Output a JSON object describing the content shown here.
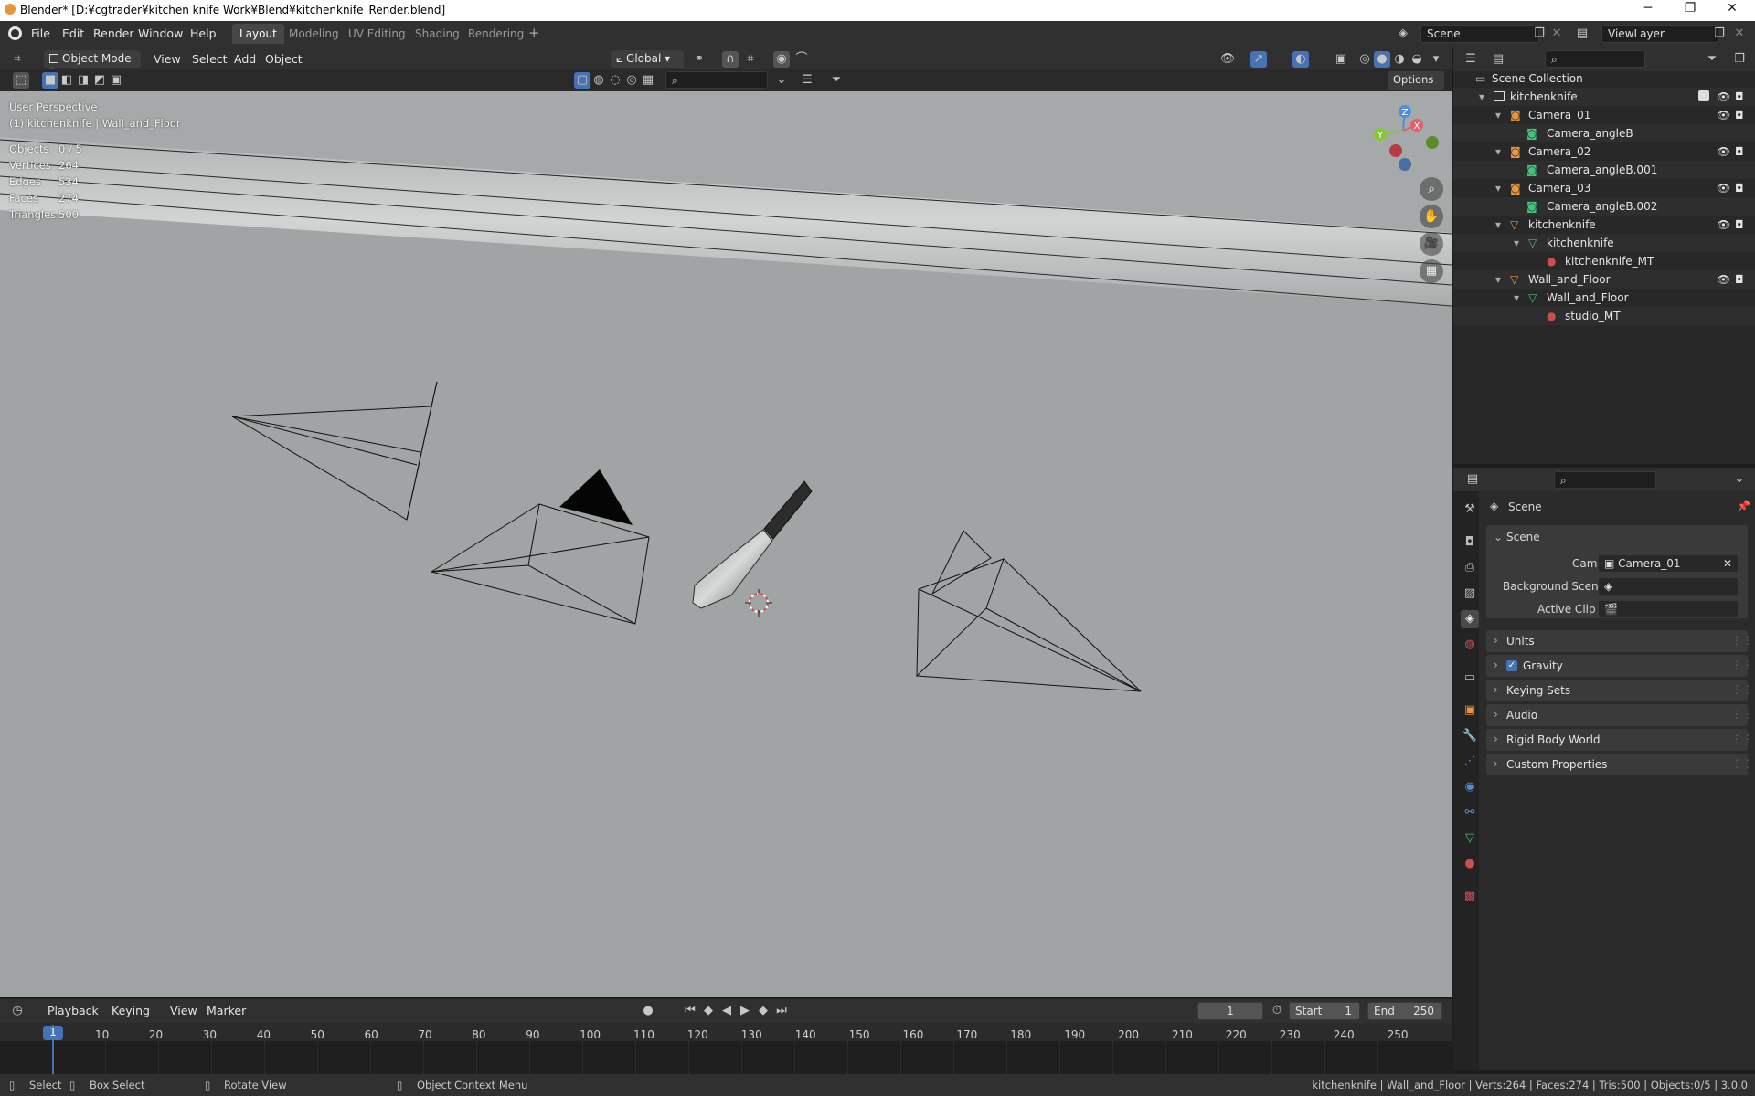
{
  "window": {
    "title": "Blender* [D:¥cgtrader¥kitchen knife Work¥Blend¥kitchenknife_Render.blend]",
    "controls": [
      "─",
      "❐",
      "✕"
    ]
  },
  "menubar": {
    "items": [
      "File",
      "Edit",
      "Render",
      "Window",
      "Help"
    ],
    "workspaces": [
      "Layout",
      "Modeling",
      "UV Editing",
      "Shading",
      "Rendering"
    ],
    "add_tab": "+",
    "scene_name": "Scene",
    "view_layer": "ViewLayer"
  },
  "viewport_header": {
    "mode": "Object Mode",
    "menus": [
      "View",
      "Select",
      "Add",
      "Object"
    ],
    "transform_orientation": "Global",
    "options_label": "Options"
  },
  "viewport": {
    "perspective": "User Perspective",
    "active": "(1) kitchenknife | Wall_and_Floor",
    "stats": [
      {
        "label": "Objects",
        "value": "0 / 5"
      },
      {
        "label": "Vertices",
        "value": "264"
      },
      {
        "label": "Edges",
        "value": "534"
      },
      {
        "label": "Faces",
        "value": "274"
      },
      {
        "label": "Triangles",
        "value": "500"
      }
    ],
    "gizmo_axes": {
      "z": "Z",
      "y": "Y",
      "x": "X"
    },
    "background_color": "#a1a4a4"
  },
  "outliner": {
    "root": "Scene Collection",
    "rows": [
      {
        "label": "kitchenknife",
        "type": "collection"
      },
      {
        "label": "Camera_01",
        "type": "camera"
      },
      {
        "label": "Camera_angleB",
        "type": "camera-data"
      },
      {
        "label": "Camera_02",
        "type": "camera"
      },
      {
        "label": "Camera_angleB.001",
        "type": "camera-data"
      },
      {
        "label": "Camera_03",
        "type": "camera"
      },
      {
        "label": "Camera_angleB.002",
        "type": "camera-data"
      },
      {
        "label": "kitchenknife",
        "type": "mesh-object"
      },
      {
        "label": "kitchenknife",
        "type": "mesh-data"
      },
      {
        "label": "kitchenknife_MT",
        "type": "material"
      },
      {
        "label": "Wall_and_Floor",
        "type": "mesh-object"
      },
      {
        "label": "Wall_and_Floor",
        "type": "mesh-data"
      },
      {
        "label": "studio_MT",
        "type": "material"
      }
    ]
  },
  "properties": {
    "context_title": "Scene",
    "section_title": "Scene",
    "camera_label": "Camera",
    "camera_value": "Camera_01",
    "background_scene_label": "Background Scene",
    "active_clip_label": "Active Clip",
    "panels": [
      "Units",
      "Gravity",
      "Keying Sets",
      "Audio",
      "Rigid Body World",
      "Custom Properties"
    ],
    "gravity_checked": true
  },
  "timeline": {
    "menus": [
      "Playback",
      "Keying",
      "View",
      "Marker"
    ],
    "current_frame": "1",
    "start_label": "Start",
    "start_value": "1",
    "end_label": "End",
    "end_value": "250",
    "ruler": [
      "1",
      "10",
      "20",
      "30",
      "40",
      "50",
      "60",
      "70",
      "80",
      "90",
      "100",
      "110",
      "120",
      "130",
      "140",
      "150",
      "160",
      "170",
      "180",
      "190",
      "200",
      "210",
      "220",
      "230",
      "240",
      "250"
    ]
  },
  "statusbar": {
    "select": "Select",
    "box_select": "Box Select",
    "rotate_view": "Rotate View",
    "context_menu": "Object Context Menu",
    "info": "kitchenknife | Wall_and_Floor | Verts:264 | Faces:274 | Tris:500 | Objects:0/5 | 3.0.0"
  },
  "colors": {
    "accent_blue": "#4772b3",
    "camera_orange": "#e8953b",
    "mesh_green": "#43c27a",
    "material_red": "#c94f4f"
  }
}
